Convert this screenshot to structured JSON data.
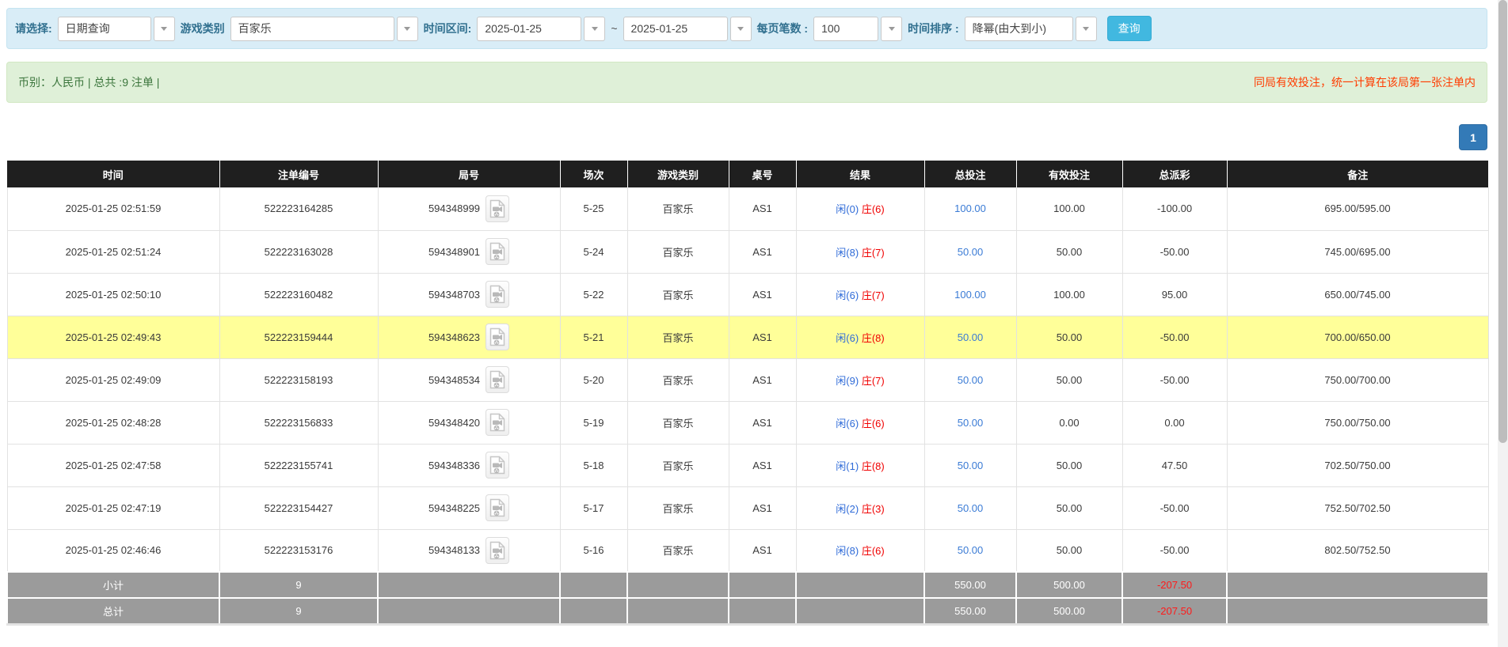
{
  "filter_bar": {
    "select_label": "请选择:",
    "select_value": "日期查询",
    "game_label": "游戏类别",
    "game_value": "百家乐",
    "range_label": "时间区间:",
    "range_start": "2025-01-25",
    "range_tilde": "~",
    "range_end": "2025-01-25",
    "page_size_label": "每页笔数 :",
    "page_size_value": "100",
    "sort_label": "时间排序 :",
    "sort_value": "降幂(由大到小)",
    "search_button": "查询"
  },
  "summary_bar": {
    "left_text": "币别：人民币 | 总共 :9 注单 |",
    "right_note": "同局有效投注，统一计算在该局第一张注单内"
  },
  "pagination": {
    "current_page": "1"
  },
  "table": {
    "headers": [
      "时间",
      "注单编号",
      "局号",
      "场次",
      "游戏类别",
      "桌号",
      "结果",
      "总投注",
      "有效投注",
      "总派彩",
      "备注"
    ],
    "video_icon_name": "video-record-icon",
    "rows": [
      {
        "time": "2025-01-25 02:51:59",
        "bet_id": "522223164285",
        "round_id": "594348999",
        "session": "5-25",
        "game": "百家乐",
        "table_no": "AS1",
        "result_player": "闲(0)",
        "result_banker": "庄(6)",
        "total_bet": "100.00",
        "valid_bet": "100.00",
        "payout": "-100.00",
        "remark": "695.00/595.00",
        "highlight": false
      },
      {
        "time": "2025-01-25 02:51:24",
        "bet_id": "522223163028",
        "round_id": "594348901",
        "session": "5-24",
        "game": "百家乐",
        "table_no": "AS1",
        "result_player": "闲(8)",
        "result_banker": "庄(7)",
        "total_bet": "50.00",
        "valid_bet": "50.00",
        "payout": "-50.00",
        "remark": "745.00/695.00",
        "highlight": false
      },
      {
        "time": "2025-01-25 02:50:10",
        "bet_id": "522223160482",
        "round_id": "594348703",
        "session": "5-22",
        "game": "百家乐",
        "table_no": "AS1",
        "result_player": "闲(6)",
        "result_banker": "庄(7)",
        "total_bet": "100.00",
        "valid_bet": "100.00",
        "payout": "95.00",
        "remark": "650.00/745.00",
        "highlight": false
      },
      {
        "time": "2025-01-25 02:49:43",
        "bet_id": "522223159444",
        "round_id": "594348623",
        "session": "5-21",
        "game": "百家乐",
        "table_no": "AS1",
        "result_player": "闲(6)",
        "result_banker": "庄(8)",
        "total_bet": "50.00",
        "valid_bet": "50.00",
        "payout": "-50.00",
        "remark": "700.00/650.00",
        "highlight": true
      },
      {
        "time": "2025-01-25 02:49:09",
        "bet_id": "522223158193",
        "round_id": "594348534",
        "session": "5-20",
        "game": "百家乐",
        "table_no": "AS1",
        "result_player": "闲(9)",
        "result_banker": "庄(7)",
        "total_bet": "50.00",
        "valid_bet": "50.00",
        "payout": "-50.00",
        "remark": "750.00/700.00",
        "highlight": false
      },
      {
        "time": "2025-01-25 02:48:28",
        "bet_id": "522223156833",
        "round_id": "594348420",
        "session": "5-19",
        "game": "百家乐",
        "table_no": "AS1",
        "result_player": "闲(6)",
        "result_banker": "庄(6)",
        "total_bet": "50.00",
        "valid_bet": "0.00",
        "payout": "0.00",
        "remark": "750.00/750.00",
        "highlight": false
      },
      {
        "time": "2025-01-25 02:47:58",
        "bet_id": "522223155741",
        "round_id": "594348336",
        "session": "5-18",
        "game": "百家乐",
        "table_no": "AS1",
        "result_player": "闲(1)",
        "result_banker": "庄(8)",
        "total_bet": "50.00",
        "valid_bet": "50.00",
        "payout": "47.50",
        "remark": "702.50/750.00",
        "highlight": false
      },
      {
        "time": "2025-01-25 02:47:19",
        "bet_id": "522223154427",
        "round_id": "594348225",
        "session": "5-17",
        "game": "百家乐",
        "table_no": "AS1",
        "result_player": "闲(2)",
        "result_banker": "庄(3)",
        "total_bet": "50.00",
        "valid_bet": "50.00",
        "payout": "-50.00",
        "remark": "752.50/702.50",
        "highlight": false
      },
      {
        "time": "2025-01-25 02:46:46",
        "bet_id": "522223153176",
        "round_id": "594348133",
        "session": "5-16",
        "game": "百家乐",
        "table_no": "AS1",
        "result_player": "闲(8)",
        "result_banker": "庄(6)",
        "total_bet": "50.00",
        "valid_bet": "50.00",
        "payout": "-50.00",
        "remark": "802.50/752.50",
        "highlight": false
      }
    ],
    "subtotal": {
      "label": "小计",
      "count": "9",
      "total_bet": "550.00",
      "valid_bet": "500.00",
      "payout": "-207.50"
    },
    "total": {
      "label": "总计",
      "count": "9",
      "total_bet": "550.00",
      "valid_bet": "500.00",
      "payout": "-207.50"
    }
  },
  "colors": {
    "filter_bar_bg": "#d9edf7",
    "filter_label": "#31708f",
    "summary_bar_bg": "#dff0d8",
    "summary_text": "#3c763d",
    "note_red": "#ff3c00",
    "search_button_bg": "#41b8e0",
    "pagination_bg": "#337ab7",
    "header_bg": "#1f1f1f",
    "highlight_yellow": "#ffff99",
    "summary_row_gray": "#9b9b9b",
    "player_blue": "#2f6bd8",
    "banker_red": "#f00000",
    "bet_link_blue": "#3a7bd5",
    "negative_red": "#f00000"
  }
}
